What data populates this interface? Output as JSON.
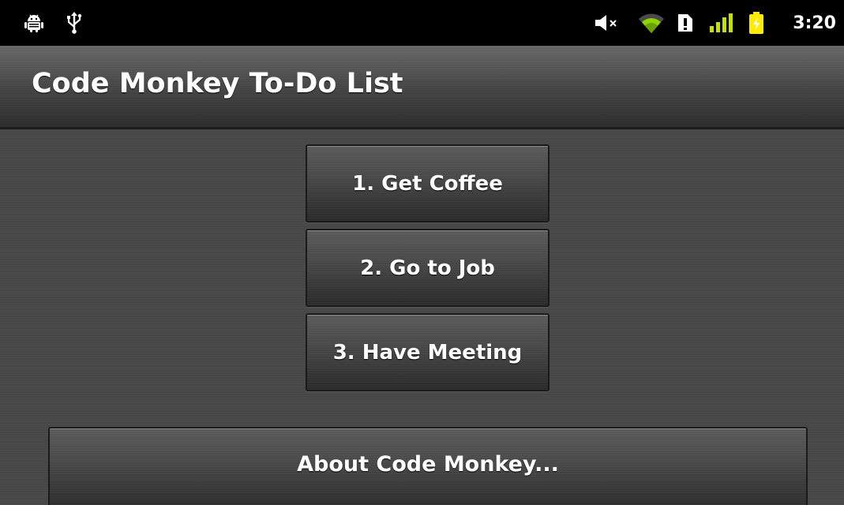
{
  "status_bar": {
    "time": "3:20",
    "icons": [
      "android-debug-icon",
      "usb-icon",
      "volume-muted-icon",
      "wifi-icon",
      "sim-alert-icon",
      "signal-icon",
      "battery-charging-icon"
    ],
    "colors": {
      "wifi": "#8fd400",
      "signal": "#c8e000",
      "battery": "#ffea00"
    }
  },
  "title_bar": {
    "title": "Code Monkey To-Do List"
  },
  "main": {
    "todo_buttons": [
      {
        "label": "1. Get Coffee"
      },
      {
        "label": "2. Go to Job"
      },
      {
        "label": "3. Have Meeting"
      }
    ],
    "about_button": {
      "label": "About Code Monkey..."
    }
  }
}
